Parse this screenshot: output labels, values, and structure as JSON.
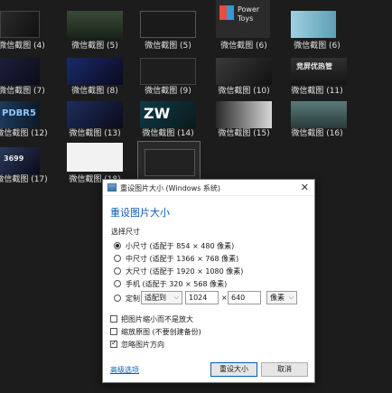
{
  "thumbnails": [
    {
      "caption": "微信截图 (4)",
      "text": ""
    },
    {
      "caption": "微信截图 (5)",
      "text": ""
    },
    {
      "caption": "微信截图 (5)",
      "text": ""
    },
    {
      "caption": "微信截图 (6)",
      "text": "Power Toys"
    },
    {
      "caption": "微信截图 (6)",
      "text": ""
    },
    {
      "caption": "微信截图 (7)",
      "text": ""
    },
    {
      "caption": "微信截图 (8)",
      "text": ""
    },
    {
      "caption": "微信截图 (9)",
      "text": ""
    },
    {
      "caption": "微信截图 (10)",
      "text": ""
    },
    {
      "caption": "微信截图 (11)",
      "text": "竞屏优热管"
    },
    {
      "caption": "微信截图 (12)",
      "text": "PDBR5"
    },
    {
      "caption": "微信截图 (13)",
      "text": ""
    },
    {
      "caption": "微信截图 (14)",
      "text": "ZW"
    },
    {
      "caption": "微信截图 (15)",
      "text": ""
    },
    {
      "caption": "微信截图 (16)",
      "text": ""
    },
    {
      "caption": "微信截图 (17)",
      "text": "3699"
    },
    {
      "caption": "微信截图 (18)",
      "text": ""
    },
    {
      "caption": "",
      "text": ""
    }
  ],
  "dialog": {
    "title": "重设图片大小 (Windows 系统)",
    "close": "✕",
    "heading": "重设图片大小",
    "section_label": "选择尺寸",
    "options": [
      {
        "label": "小尺寸 (适配于 854 × 480 像素)",
        "selected": true
      },
      {
        "label": "中尺寸 (适配于 1366 × 768 像素)",
        "selected": false
      },
      {
        "label": "大尺寸 (适配于 1920 × 1080 像素)",
        "selected": false
      },
      {
        "label": "手机 (适配于 320 × 568 像素)",
        "selected": false
      },
      {
        "label": "定制",
        "selected": false
      }
    ],
    "custom": {
      "mode": "适配到",
      "width": "1024",
      "times": "×",
      "height": "640",
      "unit": "像素"
    },
    "checkboxes": [
      {
        "label": "把图片缩小而不是放大",
        "checked": false
      },
      {
        "label": "缩放原图 (不要创建备份)",
        "checked": false
      },
      {
        "label": "忽略图片方向",
        "checked": true
      }
    ],
    "advanced_link": "高级选项",
    "resize_button": "重设大小",
    "cancel_button": "取消"
  },
  "colors": {
    "background": "#1c1c1c",
    "accent": "#0a5db5"
  }
}
